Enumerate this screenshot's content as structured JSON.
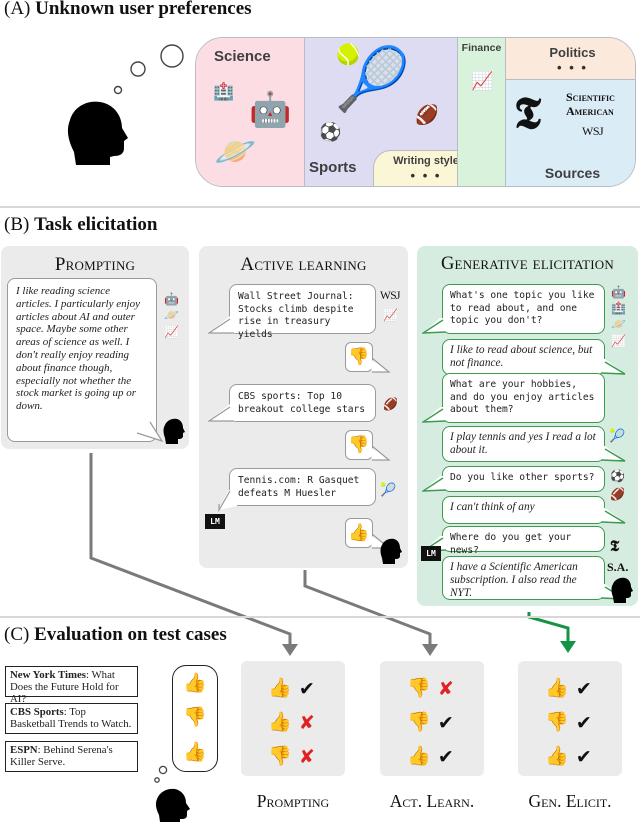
{
  "section_a": {
    "letter": "(A)",
    "title": "Unknown user preferences",
    "categories": {
      "science": {
        "label": "Science",
        "color": "#fbdde3",
        "icons": [
          "hospital-icon",
          "robot-icon",
          "ringed-planet-icon"
        ],
        "glyphs": [
          "🏥",
          "🤖",
          "🪐"
        ]
      },
      "sports": {
        "label": "Sports",
        "color": "#dedcf3",
        "icons": [
          "tennis-ball-icon",
          "soccer-ball-icon",
          "football-icon"
        ],
        "glyphs": [
          "🎾",
          "⚽",
          "🏈"
        ]
      },
      "finance": {
        "label": "Finance",
        "color": "#d9f2dc",
        "icons": [
          "chart-increasing-icon"
        ],
        "glyphs": [
          "📈"
        ]
      },
      "politics": {
        "label": "Politics",
        "color": "#fbeadc",
        "more": "• • •"
      },
      "writing_style": {
        "label": "Writing style",
        "color": "#fbf7d6",
        "more": "• • •"
      },
      "sources": {
        "label": "Sources",
        "color": "#daecf6",
        "nyt_logo": "𝕿",
        "sci_am_line1": "Scientific",
        "sci_am_line2": "American",
        "wsj": "WSJ"
      }
    }
  },
  "section_b": {
    "letter": "(B)",
    "title": "Task elicitation",
    "prompting": {
      "title": "Prompting",
      "text": "I like reading science articles. I particularly enjoy articles about AI and outer space. Maybe some other areas of science as well. I don't really enjoy reading about finance though, especially not whether the stock market is going up or down.",
      "side_icons": [
        "🤖",
        "🪐",
        "📈"
      ]
    },
    "active_learning": {
      "title": "Active learning",
      "lm_badge": "LM",
      "items": [
        {
          "text": "Wall Street Journal: Stocks climb despite rise in treasury yields",
          "source": "WSJ",
          "icon": "📈",
          "response": "👎"
        },
        {
          "text": "CBS sports: Top 10 breakout college stars",
          "icon": "🏈",
          "response": "👎"
        },
        {
          "text": "Tennis.com: R Gasquet defeats M Huesler",
          "icon": "🎾",
          "response": "👍"
        }
      ]
    },
    "generative_elicitation": {
      "title": "Generative elicitation",
      "lm_badge": "LM",
      "messages": [
        {
          "role": "lm",
          "text": "What's one topic you like to read about, and one topic you don't?"
        },
        {
          "role": "user",
          "text": "I like to read about science, but not finance."
        },
        {
          "role": "lm",
          "text": "What are your hobbies, and do you enjoy articles about them?"
        },
        {
          "role": "user",
          "text": "I play tennis and yes I read a lot about it."
        },
        {
          "role": "lm",
          "text": "Do you like other sports?"
        },
        {
          "role": "user",
          "text": "I can't think of any"
        },
        {
          "role": "lm",
          "text": "Where do you get your news?"
        },
        {
          "role": "user",
          "text": "I have a Scientific American subscription. I also read the NYT."
        }
      ],
      "side_icons": {
        "robot": "🤖",
        "hospital": "🏥",
        "planet": "🪐",
        "chart": "📈",
        "tennis": "🎾",
        "soccer": "⚽",
        "football": "🏈",
        "nyt": "𝕿",
        "sa": "S.A."
      }
    }
  },
  "section_c": {
    "letter": "(C)",
    "title": "Evaluation on test cases",
    "test_cases": [
      {
        "source": "New York Times",
        "headline": ": What Does the Future Hold for AI?"
      },
      {
        "source": "CBS Sports",
        "headline": ": Top Basketball Trends to Watch."
      },
      {
        "source": "ESPN",
        "headline": ": Behind Serena's Killer Serve."
      }
    ],
    "ground_truth": [
      "👍",
      "👎",
      "👍"
    ],
    "methods": [
      {
        "label": "Prompting",
        "predictions": [
          "👍",
          "👍",
          "👎"
        ],
        "correct": [
          "✔",
          "✘",
          "✘"
        ],
        "correct_flags": [
          true,
          false,
          false
        ]
      },
      {
        "label": "Act. Learn.",
        "predictions": [
          "👎",
          "👎",
          "👍"
        ],
        "correct": [
          "✘",
          "✔",
          "✔"
        ],
        "correct_flags": [
          false,
          true,
          true
        ]
      },
      {
        "label": "Gen. Elicit.",
        "predictions": [
          "👍",
          "👎",
          "👍"
        ],
        "correct": [
          "✔",
          "✔",
          "✔"
        ],
        "correct_flags": [
          true,
          true,
          true
        ]
      }
    ]
  },
  "colors": {
    "panel_gray": "#ebebeb",
    "panel_green": "#d6ece0",
    "green_accent": "#169445",
    "arrow_gray": "#7a7a7a",
    "error_red": "#e22222"
  }
}
